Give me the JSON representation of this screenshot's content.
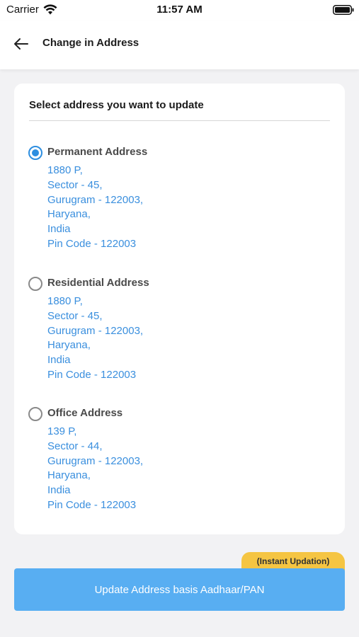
{
  "status_bar": {
    "carrier": "Carrier",
    "time": "11:57 AM",
    "icons": [
      "wifi-icon",
      "battery-icon"
    ]
  },
  "header": {
    "title": "Change in Address",
    "back_icon": "arrow-left-icon"
  },
  "card": {
    "title": "Select address you want to update",
    "addresses": [
      {
        "label": "Permanent Address",
        "selected": true,
        "lines": [
          "1880 P,",
          "Sector - 45,",
          "Gurugram - 122003,",
          "Haryana,",
          "India",
          "Pin Code - 122003"
        ]
      },
      {
        "label": "Residential Address",
        "selected": false,
        "lines": [
          "1880 P,",
          "Sector - 45,",
          "Gurugram - 122003,",
          "Haryana,",
          "India",
          "Pin Code - 122003"
        ]
      },
      {
        "label": "Office Address",
        "selected": false,
        "lines": [
          "139 P,",
          "Sector - 44,",
          "Gurugram - 122003,",
          "Haryana,",
          "India",
          "Pin Code - 122003"
        ]
      }
    ]
  },
  "footer": {
    "badge": "(Instant Updation)",
    "button_label": "Update Address basis Aadhaar/PAN"
  },
  "colors": {
    "accent": "#2d8ee0",
    "address_text": "#3a8fde",
    "button": "#58aef2",
    "badge": "#f5c542",
    "background": "#f2f2f4"
  }
}
